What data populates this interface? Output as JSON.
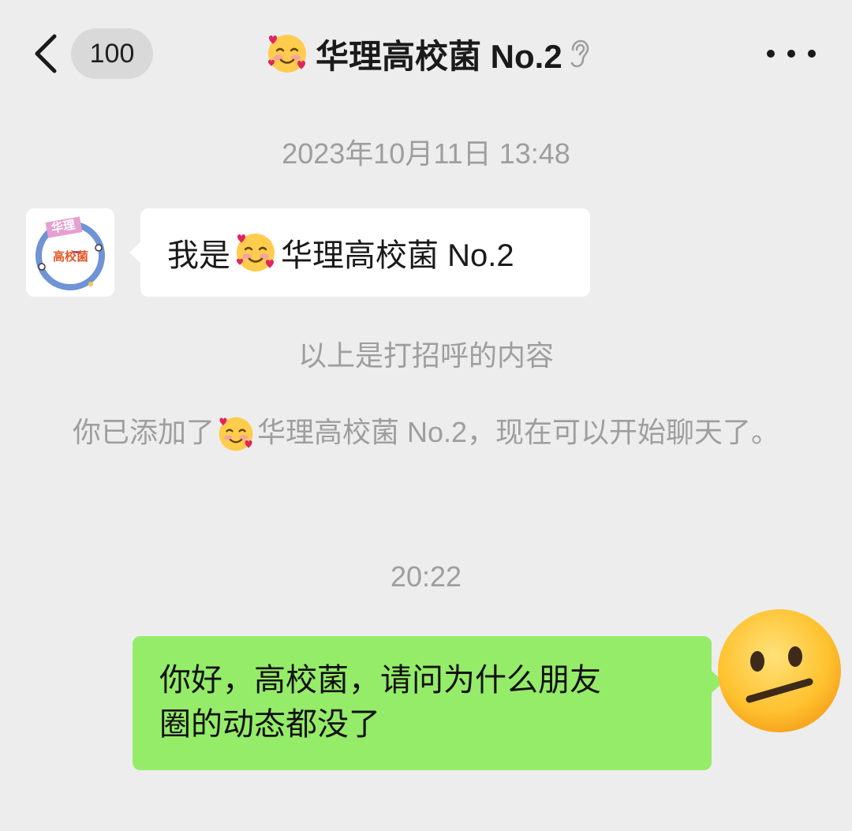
{
  "header": {
    "unread_count": "100",
    "title": "华理高校菌 No.2",
    "icons": [
      "chevron-left-icon",
      "smiling-face-with-hearts-icon",
      "ear-icon",
      "more-dots-icon"
    ]
  },
  "messages": {
    "timestamp_1": "2023年10月11日 13:48",
    "greeting": {
      "prefix": "我是",
      "name": "华理高校菌 No.2"
    },
    "avatar_left": {
      "badge_top": "华理",
      "badge_main": "高校菌"
    },
    "system_1": "以上是打招呼的内容",
    "system_2": {
      "prefix": "你已添加了",
      "suffix": "华理高校菌 No.2，现在可以开始聊天了。"
    },
    "timestamp_2": "20:22",
    "sent": {
      "line1": "你好，高校菌，请问为什么朋友",
      "line2": "圈的动态都没了"
    }
  },
  "colors": {
    "background": "#ededed",
    "sent_bubble": "#95ec69",
    "received_bubble": "#ffffff",
    "system_text": "#9e9e9e"
  }
}
